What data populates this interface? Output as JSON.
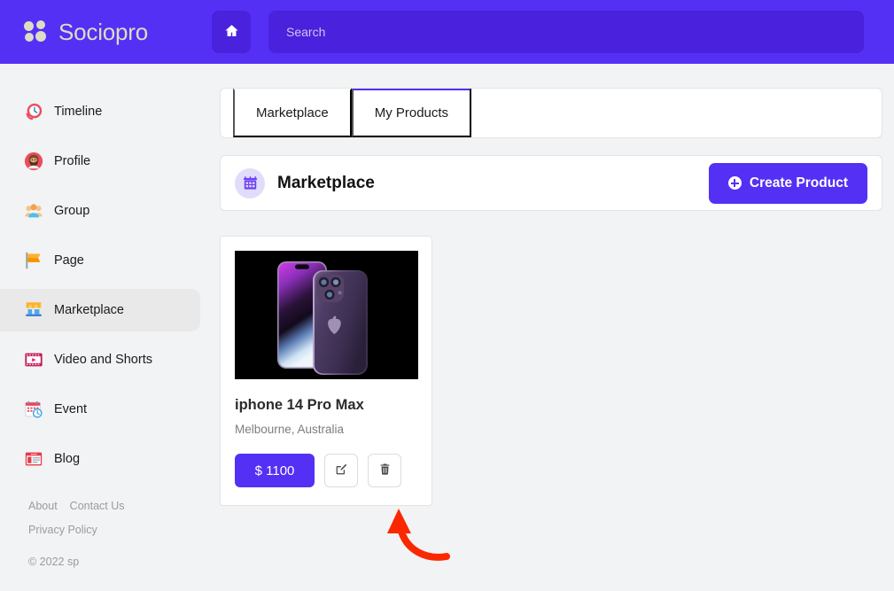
{
  "header": {
    "brand_name": "Sociopro",
    "logo_icon": "four-dot-cluster-logo",
    "home_icon": "home-icon",
    "search_placeholder": "Search",
    "search_value": "",
    "bg_color": "#5430f5",
    "field_color": "#4a21dc"
  },
  "sidebar": {
    "items": [
      {
        "label": "Timeline",
        "icon": "timeline-clock-icon",
        "active": false
      },
      {
        "label": "Profile",
        "icon": "profile-avatar-icon",
        "active": false
      },
      {
        "label": "Group",
        "icon": "group-people-icon",
        "active": false
      },
      {
        "label": "Page",
        "icon": "page-flag-icon",
        "active": false
      },
      {
        "label": "Marketplace",
        "icon": "marketplace-store-icon",
        "active": true
      },
      {
        "label": "Video and Shorts",
        "icon": "video-film-icon",
        "active": false
      },
      {
        "label": "Event",
        "icon": "event-calendar-icon",
        "active": false
      },
      {
        "label": "Blog",
        "icon": "blog-window-icon",
        "active": false
      }
    ],
    "links": [
      "About",
      "Contact Us"
    ],
    "privacy": "Privacy Policy",
    "copyright": "© 2022 sp",
    "active_bg": "#e9e9e9"
  },
  "main": {
    "tabs": [
      {
        "label": "Marketplace",
        "active": false
      },
      {
        "label": "My Products",
        "active": true
      }
    ],
    "marketplace_header": {
      "title": "Marketplace",
      "icon": "store-front-icon",
      "create_button": "Create Product",
      "create_icon": "plus-circle-icon",
      "accent": "#5430f5"
    },
    "products": [
      {
        "name": "iphone 14 Pro Max",
        "location": "Melbourne, Australia",
        "price": "$ 1100",
        "image": "iphone-14-pro-max-deep-purple-photo",
        "edit_icon": "edit-pencil-icon",
        "delete_icon": "trash-icon"
      }
    ]
  },
  "annotation": {
    "type": "curved-arrow-up",
    "color": "#fa2800",
    "points_to": "delete-product-button"
  }
}
